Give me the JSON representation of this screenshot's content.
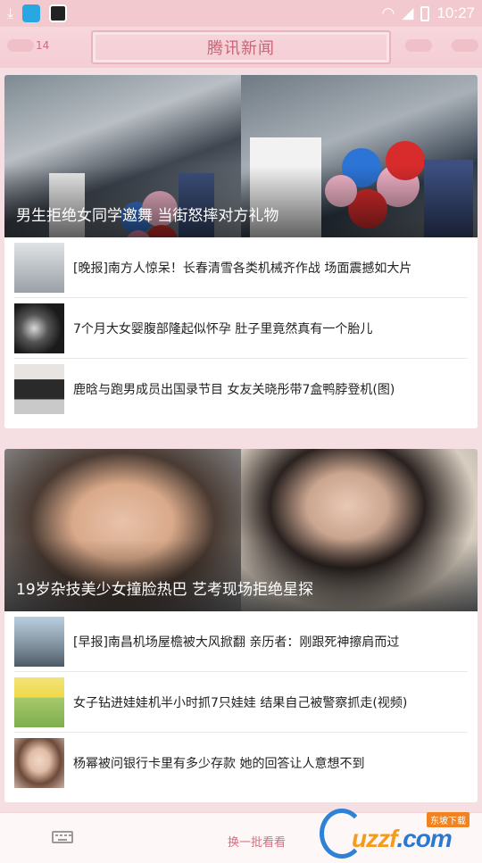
{
  "status_bar": {
    "time": "10:27"
  },
  "header": {
    "title": "腾讯新闻",
    "count": "14"
  },
  "cards": [
    {
      "hero_caption": "男生拒绝女同学邀舞 当街怒摔对方礼物",
      "items": [
        {
          "title": "[晚报]南方人惊呆！长春清雪各类机械齐作战 场面震撼如大片"
        },
        {
          "title": "7个月大女婴腹部隆起似怀孕 肚子里竟然真有一个胎儿"
        },
        {
          "title": "鹿晗与跑男成员出国录节目 女友关晓彤带7盒鸭脖登机(图)"
        }
      ]
    },
    {
      "hero_caption": "19岁杂技美少女撞脸热巴 艺考现场拒绝星探",
      "items": [
        {
          "title": "[早报]南昌机场屋檐被大风掀翻 亲历者：刚跟死神擦肩而过"
        },
        {
          "title": "女子钻进娃娃机半小时抓7只娃娃 结果自己被警察抓走(视频)"
        },
        {
          "title": "杨幂被问银行卡里有多少存款 她的回答让人意想不到"
        }
      ]
    }
  ],
  "bottom_bar": {
    "refresh_label": "换一批看看"
  },
  "watermark": {
    "text_main": "uzzf",
    "text_suffix": ".com",
    "tag": "东坡下载"
  }
}
